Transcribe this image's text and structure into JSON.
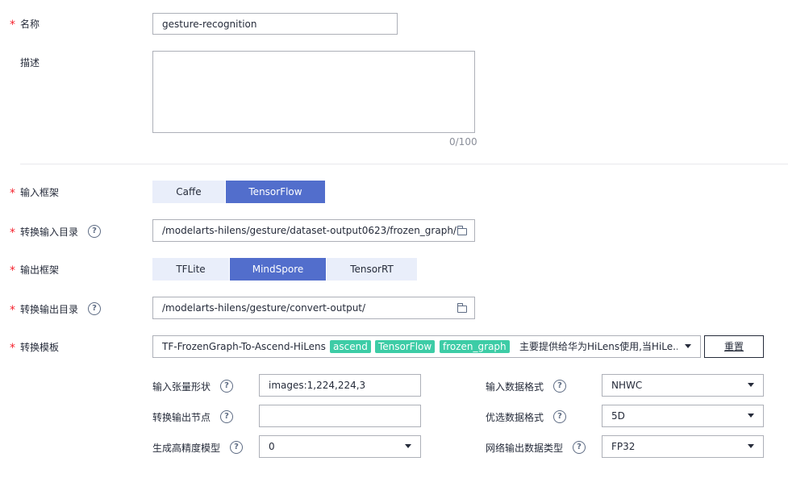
{
  "form": {
    "required_mark": "*",
    "name_label": "名称",
    "name_value": "gesture-recognition",
    "desc_label": "描述",
    "desc_count": "0/100",
    "framework_in_label": "输入框架",
    "framework_in_options": [
      "Caffe",
      "TensorFlow"
    ],
    "framework_in_selected": "TensorFlow",
    "input_dir_label": "转换输入目录",
    "input_dir_value": "/modelarts-hilens/gesture/dataset-output0623/frozen_graph/",
    "framework_out_label": "输出框架",
    "framework_out_options": [
      "TFLite",
      "MindSpore",
      "TensorRT"
    ],
    "framework_out_selected": "MindSpore",
    "output_dir_label": "转换输出目录",
    "output_dir_value": "/modelarts-hilens/gesture/convert-output/",
    "template_label": "转换模板",
    "template_name": "TF-FrozenGraph-To-Ascend-HiLens",
    "template_tags": [
      "ascend",
      "TensorFlow",
      "frozen_graph"
    ],
    "template_desc": "主要提供给华为HiLens使用,当HiLe...",
    "reset_label": "重置",
    "help_glyph": "?"
  },
  "params": {
    "tensor_shape_label": "输入张量形状",
    "tensor_shape_value": "images:1,224,224,3",
    "output_node_label": "转换输出节点",
    "output_node_value": "",
    "high_precision_label": "生成高精度模型",
    "high_precision_value": "0",
    "input_format_label": "输入数据格式",
    "input_format_value": "NHWC",
    "pref_format_label": "优选数据格式",
    "pref_format_value": "5D",
    "net_output_type_label": "网络输出数据类型",
    "net_output_type_value": "FP32"
  },
  "colors": {
    "accent": "#526ecc",
    "tag": "#3dcca6",
    "required": "#f5222d"
  },
  "icons": {
    "folder": "folder-icon",
    "help": "help-icon",
    "dropdown": "chevron-down-icon"
  }
}
